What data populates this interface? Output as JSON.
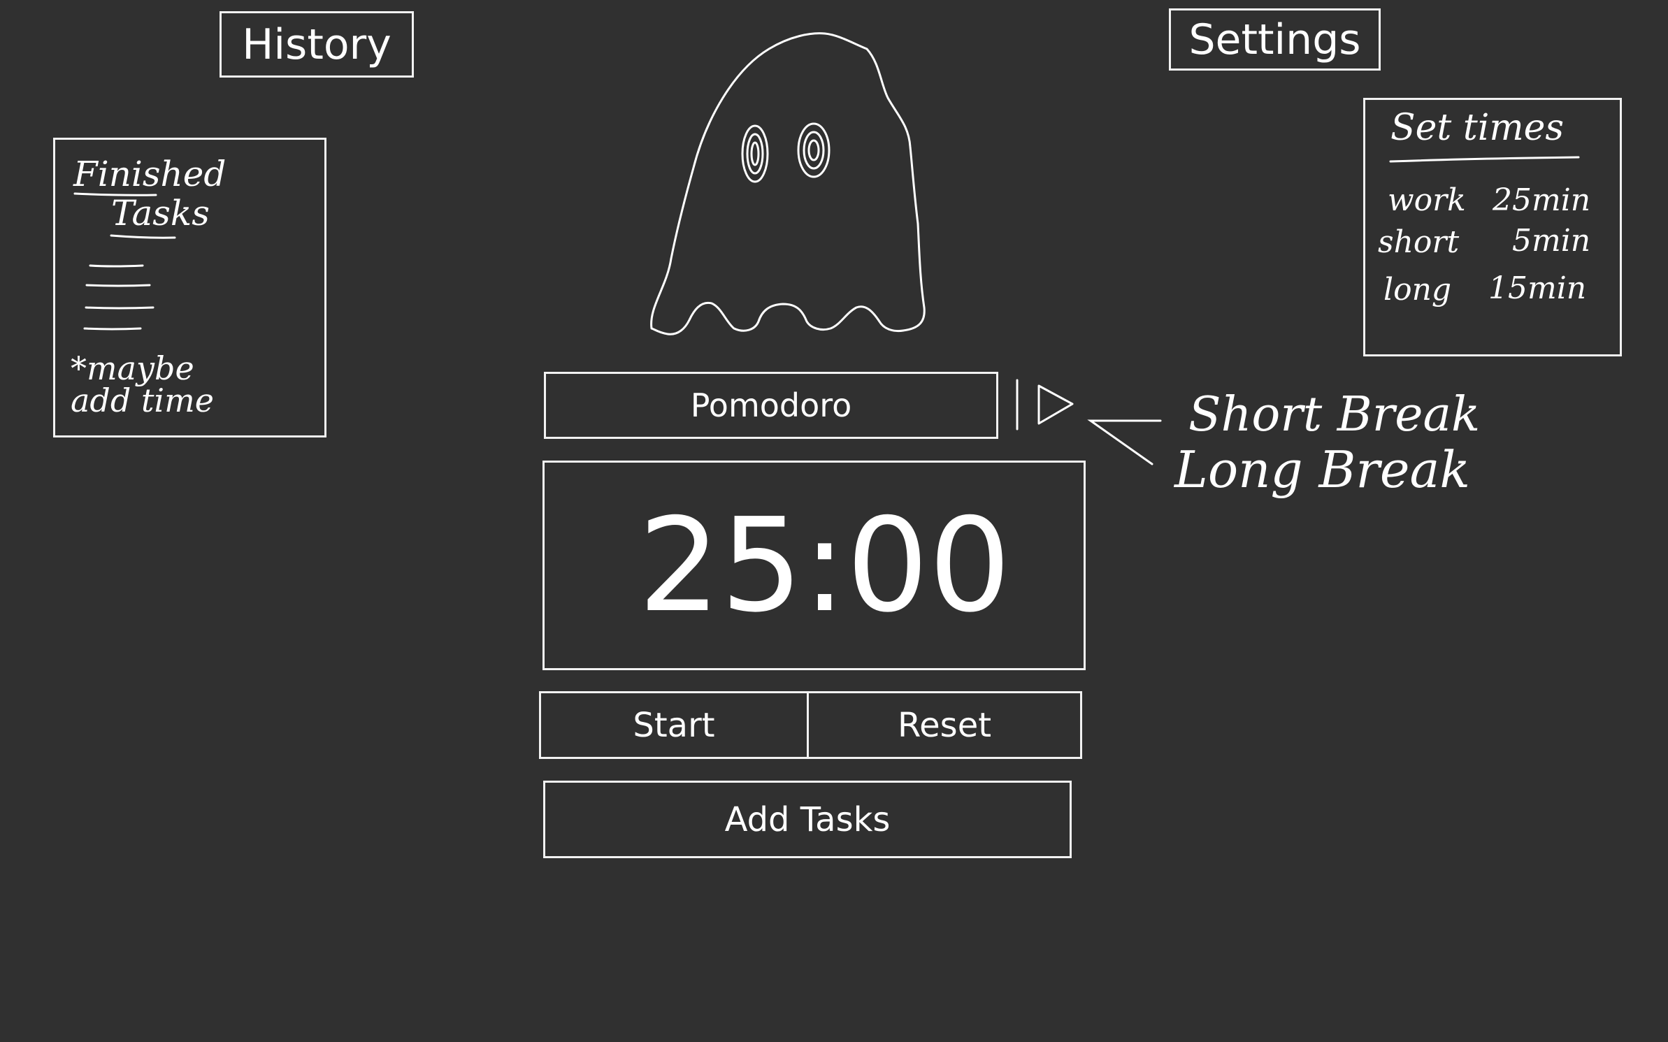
{
  "header": {
    "history_label": "History",
    "settings_label": "Settings"
  },
  "history_panel": {
    "title_line1": "Finished",
    "title_line2": "Tasks",
    "note_line1": "*maybe",
    "note_line2": "add time"
  },
  "settings_panel": {
    "title": "Set times",
    "rows": [
      {
        "label": "work",
        "value": "25min"
      },
      {
        "label": "short",
        "value": "5min"
      },
      {
        "label": "long",
        "value": "15min"
      }
    ]
  },
  "timer": {
    "mode_label": "Pomodoro",
    "display": "25:00",
    "start_label": "Start",
    "reset_label": "Reset",
    "add_tasks_label": "Add Tasks"
  },
  "mode_options": {
    "option1": "Short Break",
    "option2": "Long Break"
  },
  "colors": {
    "background": "#303030",
    "foreground": "#ffffff"
  }
}
